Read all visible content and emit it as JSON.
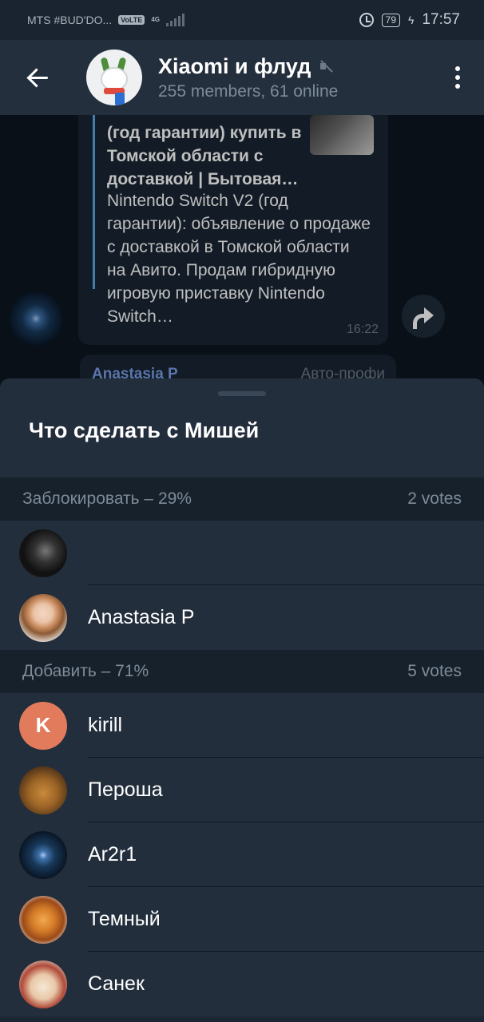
{
  "status_bar": {
    "carrier": "MTS #BUD'DO...",
    "volte": "VoLTE",
    "network": "4G",
    "battery": "79",
    "time": "17:57"
  },
  "header": {
    "title": "Xiaomi и флуд",
    "subtitle": "255 members, 61 online"
  },
  "message": {
    "link_title": "(год гарантии) купить в Томской области с доставкой | Бытовая…",
    "link_description": "Nintendo Switch V2 (год гарантии): объявление о продаже с доставкой в Томской области на Авито. Продам гибридную игровую приставку Nintendo Switch…",
    "time": "16:22"
  },
  "reply_preview": {
    "author": "Anastasia P",
    "meta": "Авто-профи"
  },
  "poll": {
    "title": "Что сделать с Мишей",
    "options": [
      {
        "label": "Заблокировать – 29%",
        "votes": "2 votes",
        "voters": [
          {
            "name": ""
          },
          {
            "name": "Anastasia P"
          }
        ]
      },
      {
        "label": "Добавить – 71%",
        "votes": "5 votes",
        "voters": [
          {
            "name": "kirill",
            "initial": "K"
          },
          {
            "name": "Пероша"
          },
          {
            "name": "Ar2r1"
          },
          {
            "name": "Темный"
          },
          {
            "name": "Санек"
          }
        ]
      }
    ]
  },
  "colors": {
    "background": "#17212b",
    "header": "#242f3d",
    "accent_blue": "#5aa8e6",
    "avatar_orange": "#e17b5c",
    "reply_author": "#7b9ee5"
  }
}
